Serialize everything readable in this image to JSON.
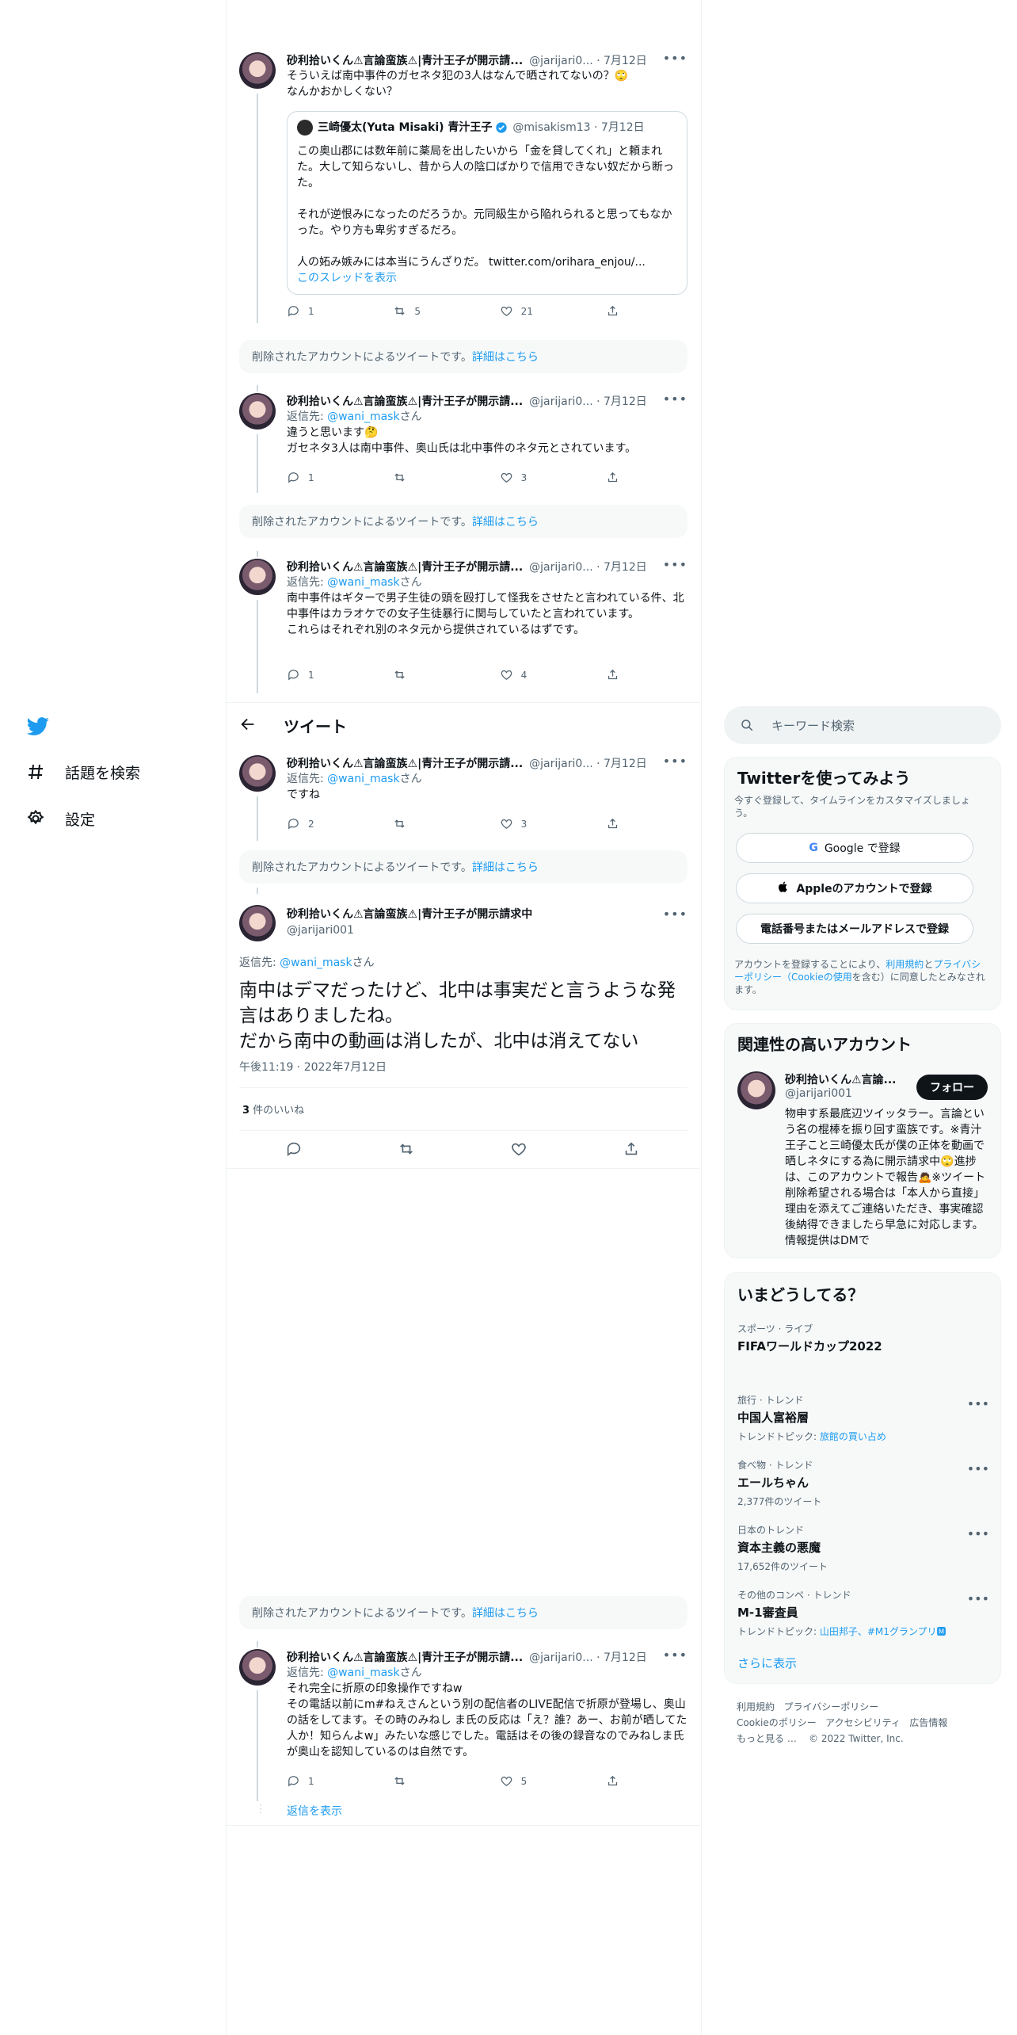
{
  "nav": {
    "explore_label": "話題を検索",
    "settings_label": "設定"
  },
  "header": {
    "title": "ツイート"
  },
  "tweets": [
    {
      "name": "砂利拾いくん⚠言論蛮族⚠|青汁王子が開示請...",
      "handle": "@jarijari0... · 7月12日",
      "text": "そういえば南中事件のガセネタ犯の3人はなんで晒されてないの？🙄\nなんかおかしくない？",
      "replies": "1",
      "retweets": "5",
      "likes": "21"
    },
    {
      "name": "砂利拾いくん⚠言論蛮族⚠|青汁王子が開示請...",
      "handle": "@jarijari0... · 7月12日",
      "reply_prefix": "返信先: ",
      "reply_to": "@wani_mask",
      "reply_suffix": "さん",
      "text": "違うと思います🤔\nガセネタ3人は南中事件、奥山氏は北中事件のネタ元とされています。",
      "replies": "1",
      "retweets": "",
      "likes": "3"
    },
    {
      "name": "砂利拾いくん⚠言論蛮族⚠|青汁王子が開示請...",
      "handle": "@jarijari0... · 7月12日",
      "reply_prefix": "返信先: ",
      "reply_to": "@wani_mask",
      "reply_suffix": "さん",
      "text": "南中事件はギターで男子生徒の頭を殴打して怪我をさせたと言われている件、北中事件はカラオケでの女子生徒暴行に関与していたと言われています。\nこれらはそれぞれ別のネタ元から提供されているはずです。",
      "replies": "1",
      "retweets": "",
      "likes": "4"
    },
    {
      "name": "砂利拾いくん⚠言論蛮族⚠|青汁王子が開示請...",
      "handle": "@jarijari0... · 7月12日",
      "reply_prefix": "返信先: ",
      "reply_to": "@wani_mask",
      "reply_suffix": "さん",
      "text": "ですね",
      "replies": "2",
      "retweets": "",
      "likes": "3"
    },
    {
      "name": "砂利拾いくん⚠言論蛮族⚠|青汁王子が開示請...",
      "handle": "@jarijari0... · 7月12日",
      "reply_prefix": "返信先: ",
      "reply_to": "@wani_mask",
      "reply_suffix": "さん",
      "text": "それ完全に折原の印象操作ですねw\nその電話以前にm#ねえさんという別の配信者のLIVE配信で折原が登場し、奥山の話をしてます。その時のみねし ま氏の反応は「え？誰？あー、お前が晒してた人か！知らんよw」みたいな感じでした。電話はその後の録音なのでみねしま氏が奥山を認知しているのは自然です。",
      "replies": "1",
      "retweets": "",
      "likes": "5",
      "show_replies": "返信を表示"
    }
  ],
  "quote": {
    "name": "三崎優太(Yuta Misaki) 青汁王子",
    "handle": "@misakism13 · 7月12日",
    "text1": "この奥山郡には数年前に薬局を出したいから「金を貸してくれ」と頼まれた。大して知らないし、昔から人の陰口ばかりで信用できない奴だから断った。",
    "text2": "それが逆恨みになったのだろうか。元同級生から陥れられると思ってもなかった。やり方も卑劣すぎるだろ。",
    "text3": "人の妬み嫉みには本当にうんざりだ。 twitter.com/orihara_enjou/...",
    "show_thread": "このスレッドを表示"
  },
  "deleted": {
    "text": "削除されたアカウントによるツイートです。",
    "link": "詳細はこちら"
  },
  "main_tweet": {
    "name": "砂利拾いくん⚠言論蛮族⚠|青汁王子が開示請求中",
    "handle": "@jarijari001",
    "reply_prefix": "返信先: ",
    "reply_to": "@wani_mask",
    "reply_suffix": "さん",
    "text": "南中はデマだったけど、北中は事実だと言うような発言はありましたね。\nだから南中の動画は消したが、北中は消えてない",
    "timestamp": "午後11:19 · 2022年7月12日",
    "likes_count": "3",
    "likes_label": " 件のいいね"
  },
  "search": {
    "placeholder": "キーワード検索"
  },
  "signup": {
    "title": "Twitterを使ってみよう",
    "subtitle": "今すぐ登録して、タイムラインをカスタマイズしましょう。",
    "google": "Google で登録",
    "apple": "Appleのアカウントで登録",
    "phone": "電話番号またはメールアドレスで登録",
    "terms_pre": "アカウントを登録することにより、",
    "terms_link1": "利用規約",
    "terms_mid": "と",
    "terms_link2": "プライバシーポリシー",
    "terms_link3": "（Cookieの使用",
    "terms_post": "を含む）に同意したとみなされます。"
  },
  "related": {
    "title": "関連性の高いアカウント",
    "name": "砂利拾いくん⚠言論...",
    "handle": "@jarijari001",
    "follow": "フォロー",
    "bio": "物申す系最底辺ツイッタラー。言論という名の棍棒を振り回す蛮族です。※青汁王子こと三崎優太氏が僕の正体を動画で晒しネタにする為に開示請求中🙄進捗は、このアカウントで報告🙇※ツイート削除希望される場合は「本人から直接」理由を添えてご連絡いただき、事実確認後納得できましたら早急に対応します。情報提供はDMで"
  },
  "trends": {
    "title": "いまどうしてる？",
    "items": [
      {
        "category": "スポーツ · ライブ",
        "name": "FIFAワールドカップ2022",
        "sub": ""
      },
      {
        "category": "旅行 · トレンド",
        "name": "中国人富裕層",
        "sub_prefix": "トレンドトピック: ",
        "sub_link": "旅館の買い占め"
      },
      {
        "category": "食べ物 · トレンド",
        "name": "エールちゃん",
        "sub": "2,377件のツイート"
      },
      {
        "category": "日本のトレンド",
        "name": "資本主義の悪魔",
        "sub": "17,652件のツイート"
      },
      {
        "category": "その他のコンペ · トレンド",
        "name": "M-1審査員",
        "sub_prefix": "トレンドトピック: ",
        "sub_link": "山田邦子、#M1グランプリ🅼"
      }
    ],
    "show_more": "さらに表示"
  },
  "footer": {
    "line1": "利用規約   プライバシーポリシー",
    "line2": "Cookieのポリシー   アクセシビリティ   広告情報",
    "line3": "もっと見る …    © 2022 Twitter, Inc."
  }
}
